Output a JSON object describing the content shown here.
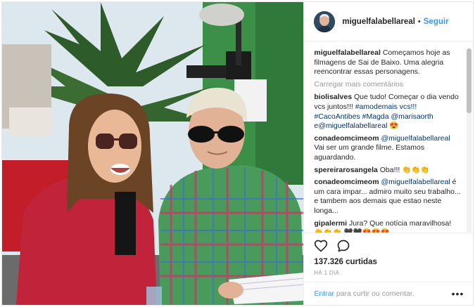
{
  "post": {
    "username": "miguelfalabellareal",
    "follow_label": "Seguir",
    "dot": "•"
  },
  "caption": {
    "username": "miguelfalabellareal",
    "text": "Começamos hoje as filmagens de Sai de Baixo. Uma alegria reencontrar essas personagens."
  },
  "load_more": "Carregar mais comentários",
  "comments": [
    {
      "user": "biolisalves",
      "text": "Que tudo! Começar o dia vendo vcs juntos!!! ",
      "tags": "#amodemais vcs!!! #CacoAntibes #Magda @marisaorth e@miguelfalabellareal 😍"
    },
    {
      "user": "conadeomcimeom",
      "text": "",
      "tags": "@miguelfalabellareal",
      "text2": " Vai ser um grande filme. Estamos aguardando."
    },
    {
      "user": "spereirarosangela",
      "text": "Oba!!! 👏👏👏"
    },
    {
      "user": "conadeomcimeom",
      "text": "",
      "tags": "@miguelfalabellareal",
      "text2": " é um cara impar... admiro muito seu trabalho... e tambem aos demais que estao neste longa..."
    },
    {
      "user": "gipalermi",
      "text": "Jura? Que notícia maravilhosa! 👏👏👏 🖤🖤😍😍😍"
    }
  ],
  "likes": "137.326 curtidas",
  "time": "HÁ 1 DIA",
  "add_comment": {
    "login_label": "Entrar",
    "rest_label": " para curtir ou comentar.",
    "more_label": "•••"
  },
  "icons": {
    "like": "heart-icon",
    "comment": "comment-bubble-icon",
    "options": "more-options-icon"
  }
}
